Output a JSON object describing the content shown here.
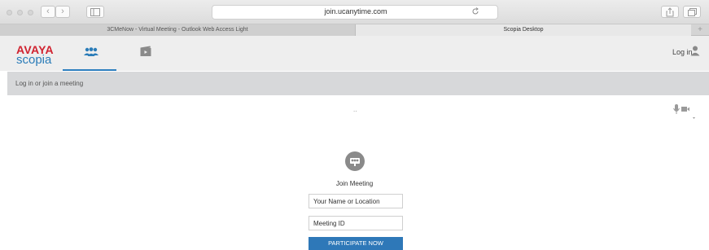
{
  "browser": {
    "url": "join.ucanytime.com",
    "tabs": [
      {
        "label": "3CMeNow - Virtual Meeting - Outlook Web Access Light"
      },
      {
        "label": "Scopia Desktop"
      }
    ],
    "new_tab_label": "+",
    "back_label": "‹",
    "forward_label": "›"
  },
  "header": {
    "brand": "AVAYA",
    "product": "scopia",
    "login_label": "Log in"
  },
  "subheader": {
    "text": "Log in or join a meeting"
  },
  "status": {
    "dots": ".."
  },
  "join": {
    "title": "Join Meeting",
    "name_placeholder": "Your Name or Location",
    "meeting_id_placeholder": "Meeting ID",
    "participate_label": "PARTICIPATE NOW"
  },
  "colors": {
    "brand_red": "#d0222f",
    "brand_blue": "#2a7cb8",
    "accent": "#2e78b8"
  },
  "icons": {
    "meetings": "people-icon",
    "recordings": "film-icon",
    "user": "user-icon",
    "media": "microphone-camera-icon",
    "join": "meeting-room-icon"
  }
}
